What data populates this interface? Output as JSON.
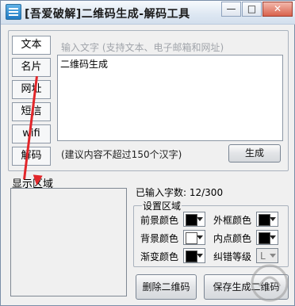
{
  "window": {
    "title": "[吾爱破解]二维码生成-解码工具",
    "controls": {
      "minimize": "—",
      "restore": "□",
      "close": "✕"
    }
  },
  "tabs": [
    {
      "label": "文本"
    },
    {
      "label": "名片"
    },
    {
      "label": "网址"
    },
    {
      "label": "短信"
    },
    {
      "label": "wifi"
    },
    {
      "label": "解码"
    }
  ],
  "input": {
    "placeholder": "输入文字 (支持文本、电子邮箱和网址)",
    "value": "二维码生成",
    "hint": "(建议内容不超过150个汉字)"
  },
  "buttons": {
    "generate": "生成",
    "delete": "删除二维码",
    "save": "保存生成二维码"
  },
  "display": {
    "label": "显示区域"
  },
  "status": {
    "char_count": "已输入字数: 12/300"
  },
  "settings": {
    "title": "设置区域",
    "foreground_label": "前景颜色",
    "background_label": "背景颜色",
    "gradient_label": "渐变颜色",
    "frame_label": "外框颜色",
    "inner_dot_label": "内点颜色",
    "error_level_label": "纠错等级",
    "error_level_value": "L"
  },
  "colors": {
    "foreground": "#000000",
    "background": "#ffffff",
    "gradient": "#000000",
    "frame": "#000000",
    "inner_dot": "#000000",
    "annotation_arrow": "#e2262a"
  }
}
